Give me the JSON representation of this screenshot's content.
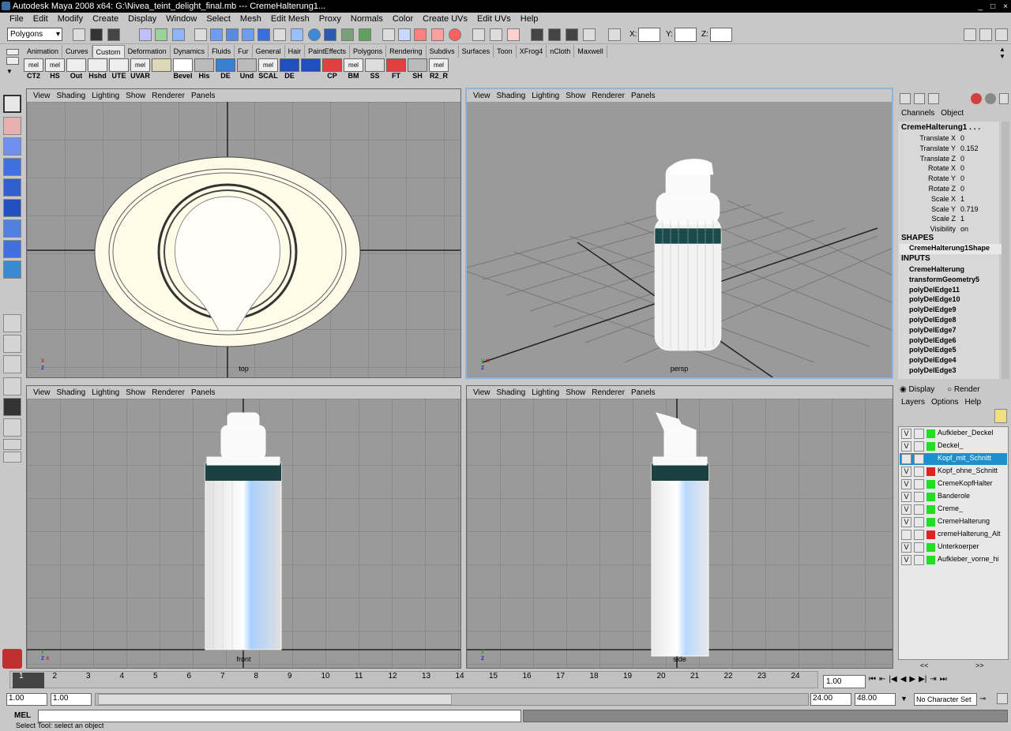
{
  "window": {
    "title": "Autodesk Maya 2008 x64: G:\\Nivea_teint_delight_final.mb  ---  CremeHalterung1...",
    "controls": [
      "_",
      "□",
      "×"
    ]
  },
  "menus": [
    "File",
    "Edit",
    "Modify",
    "Create",
    "Display",
    "Window",
    "Select",
    "Mesh",
    "Edit Mesh",
    "Proxy",
    "Normals",
    "Color",
    "Create UVs",
    "Edit UVs",
    "Help"
  ],
  "status": {
    "mode": "Polygons",
    "x_label": "X:",
    "y_label": "Y:",
    "z_label": "Z:"
  },
  "shelf_tabs": [
    "Animation",
    "Curves",
    "Custom",
    "Deformation",
    "Dynamics",
    "Fluids",
    "Fur",
    "General",
    "Hair",
    "PaintEffects",
    "Polygons",
    "Rendering",
    "Subdivs",
    "Surfaces",
    "Toon",
    "XFrog4",
    "nCloth",
    "Maxwell"
  ],
  "shelf_active": "Custom",
  "shelf_buttons": [
    {
      "icon": "mel",
      "label": "CT2"
    },
    {
      "icon": "mel",
      "label": "HS"
    },
    {
      "icon": "",
      "label": "Out"
    },
    {
      "icon": "",
      "label": "Hshd"
    },
    {
      "icon": "",
      "label": "UTE"
    },
    {
      "icon": "mel",
      "label": "UVAR"
    },
    {
      "icon": "",
      "label": ""
    },
    {
      "icon": "",
      "label": "Bevel"
    },
    {
      "icon": "",
      "label": "His"
    },
    {
      "icon": "",
      "label": "DE"
    },
    {
      "icon": "",
      "label": "Und"
    },
    {
      "icon": "mel",
      "label": "SCAL"
    },
    {
      "icon": "",
      "label": "DE"
    },
    {
      "icon": "",
      "label": ""
    },
    {
      "icon": "",
      "label": "CP"
    },
    {
      "icon": "mel",
      "label": "BM"
    },
    {
      "icon": "",
      "label": "SS"
    },
    {
      "icon": "",
      "label": "FT"
    },
    {
      "icon": "",
      "label": "SH"
    },
    {
      "icon": "mel",
      "label": "R2_R"
    }
  ],
  "panel_menu": [
    "View",
    "Shading",
    "Lighting",
    "Show",
    "Renderer",
    "Panels"
  ],
  "viewports": {
    "top": "top",
    "persp": "persp",
    "front": "front",
    "side": "side"
  },
  "channelbox": {
    "tabs": [
      "Channels",
      "Object"
    ],
    "object": "CremeHalterung1 . . .",
    "attrs": [
      {
        "k": "Translate X",
        "v": "0"
      },
      {
        "k": "Translate Y",
        "v": "0.152"
      },
      {
        "k": "Translate Z",
        "v": "0"
      },
      {
        "k": "Rotate X",
        "v": "0"
      },
      {
        "k": "Rotate Y",
        "v": "0"
      },
      {
        "k": "Rotate Z",
        "v": "0"
      },
      {
        "k": "Scale X",
        "v": "1"
      },
      {
        "k": "Scale Y",
        "v": "0.719"
      },
      {
        "k": "Scale Z",
        "v": "1"
      },
      {
        "k": "Visibility",
        "v": "on"
      }
    ],
    "shapes_head": "SHAPES",
    "shape": "CremeHalterung1Shape",
    "inputs_head": "INPUTS",
    "inputs": [
      "CremeHalterung",
      "transformGeometry5",
      "polyDelEdge11",
      "polyDelEdge10",
      "polyDelEdge9",
      "polyDelEdge8",
      "polyDelEdge7",
      "polyDelEdge6",
      "polyDelEdge5",
      "polyDelEdge4",
      "polyDelEdge3"
    ]
  },
  "layers": {
    "display": "Display",
    "render": "Render",
    "menu": [
      "Layers",
      "Options",
      "Help"
    ],
    "items": [
      {
        "v": "V",
        "color": "#22dd22",
        "name": "Aufkleber_Deckel",
        "sel": false
      },
      {
        "v": "V",
        "color": "#22dd22",
        "name": "Deckel_",
        "sel": false
      },
      {
        "v": "",
        "color": "#1e8fce",
        "name": "Kopf_mit_Schnitt",
        "sel": true
      },
      {
        "v": "V",
        "color": "#dd2222",
        "name": "Kopf_ohne_Schnitt",
        "sel": false
      },
      {
        "v": "V",
        "color": "#22dd22",
        "name": "CremeKopfHalter",
        "sel": false
      },
      {
        "v": "V",
        "color": "#22dd22",
        "name": "Banderole",
        "sel": false
      },
      {
        "v": "V",
        "color": "#22dd22",
        "name": "Creme_",
        "sel": false
      },
      {
        "v": "V",
        "color": "#22dd22",
        "name": "CremeHalterung",
        "sel": false
      },
      {
        "v": "",
        "color": "#dd2222",
        "name": "cremeHalterung_Alt",
        "sel": false
      },
      {
        "v": "V",
        "color": "#22dd22",
        "name": "Unterkoerper",
        "sel": false
      },
      {
        "v": "V",
        "color": "#22dd22",
        "name": "Aufkleber_vorne_hi",
        "sel": false
      }
    ]
  },
  "timeline": {
    "ticks": [
      "1",
      "2",
      "3",
      "4",
      "5",
      "6",
      "7",
      "8",
      "9",
      "10",
      "11",
      "12",
      "13",
      "14",
      "15",
      "16",
      "17",
      "18",
      "19",
      "20",
      "21",
      "22",
      "23",
      "24"
    ],
    "current": "1.00"
  },
  "range": {
    "start": "1.00",
    "start2": "1.00",
    "end": "24.00",
    "end2": "48.00",
    "charset": "No Character Set"
  },
  "cmd": {
    "label": "MEL"
  },
  "help": "Select Tool: select an object"
}
